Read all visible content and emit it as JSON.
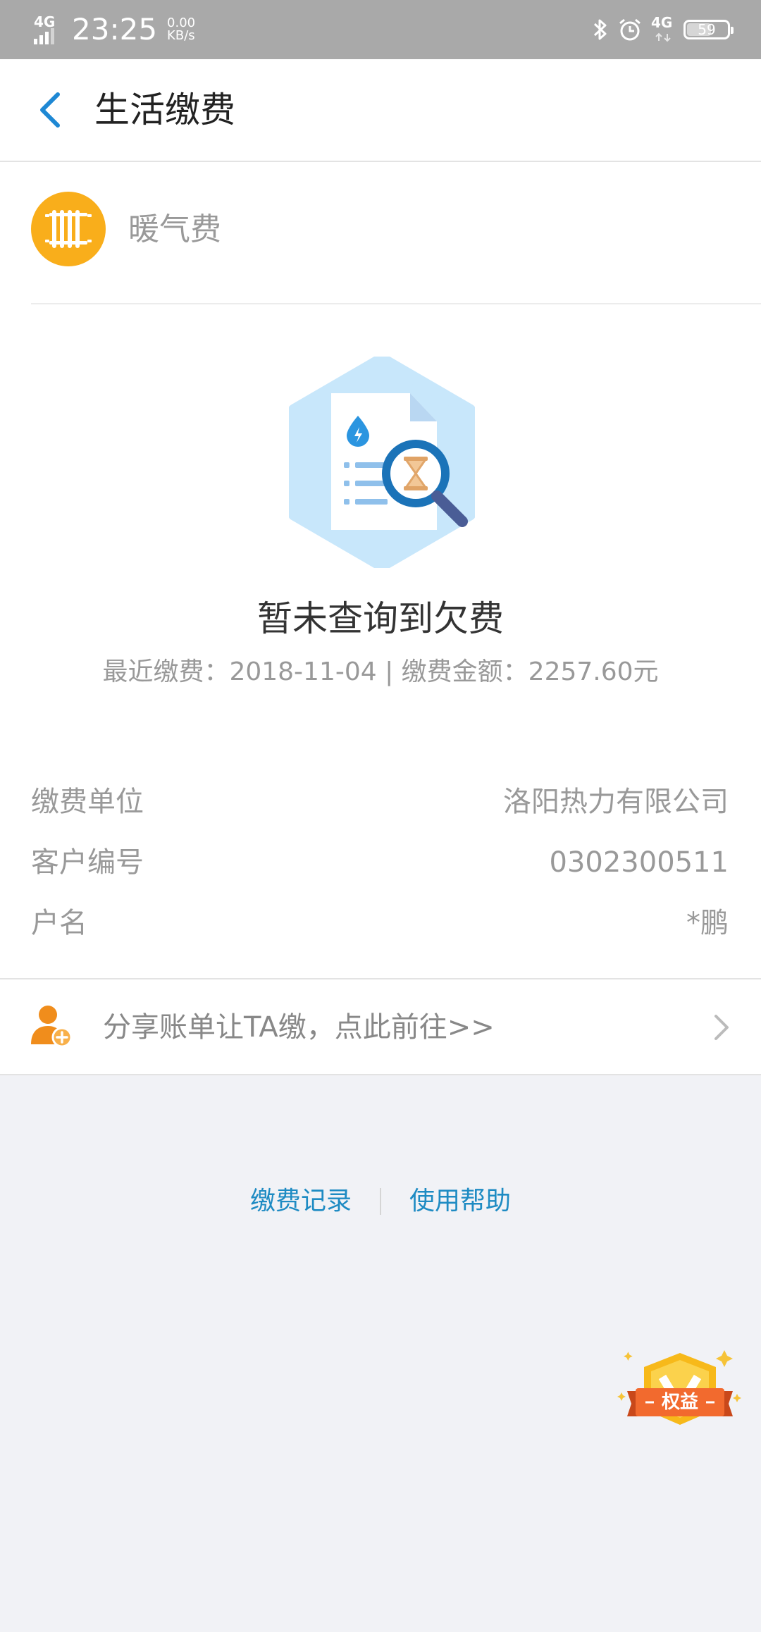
{
  "status_bar": {
    "network_left": "4G",
    "time": "23:25",
    "speed_value": "0.00",
    "speed_unit": "KB/s",
    "network_right": "4G",
    "battery": "59"
  },
  "header": {
    "title": "生活缴费"
  },
  "fee": {
    "name": "暖气费"
  },
  "empty_state": {
    "title": "暂未查询到欠费",
    "subtitle": "最近缴费：2018-11-04 | 缴费金额：2257.60元"
  },
  "info": [
    {
      "label": "缴费单位",
      "value": "洛阳热力有限公司"
    },
    {
      "label": "客户编号",
      "value": "0302300511"
    },
    {
      "label": "户名",
      "value": "*鹏"
    }
  ],
  "share": {
    "text": "分享账单让TA缴，点此前往>>"
  },
  "footer": {
    "records": "缴费记录",
    "help": "使用帮助"
  },
  "badge": {
    "label": "权益"
  },
  "colors": {
    "accent": "#1e8bc3",
    "fee_icon_bg": "#f9ae1b",
    "share_icon": "#f08d1c",
    "badge_ribbon": "#f26a2e"
  }
}
